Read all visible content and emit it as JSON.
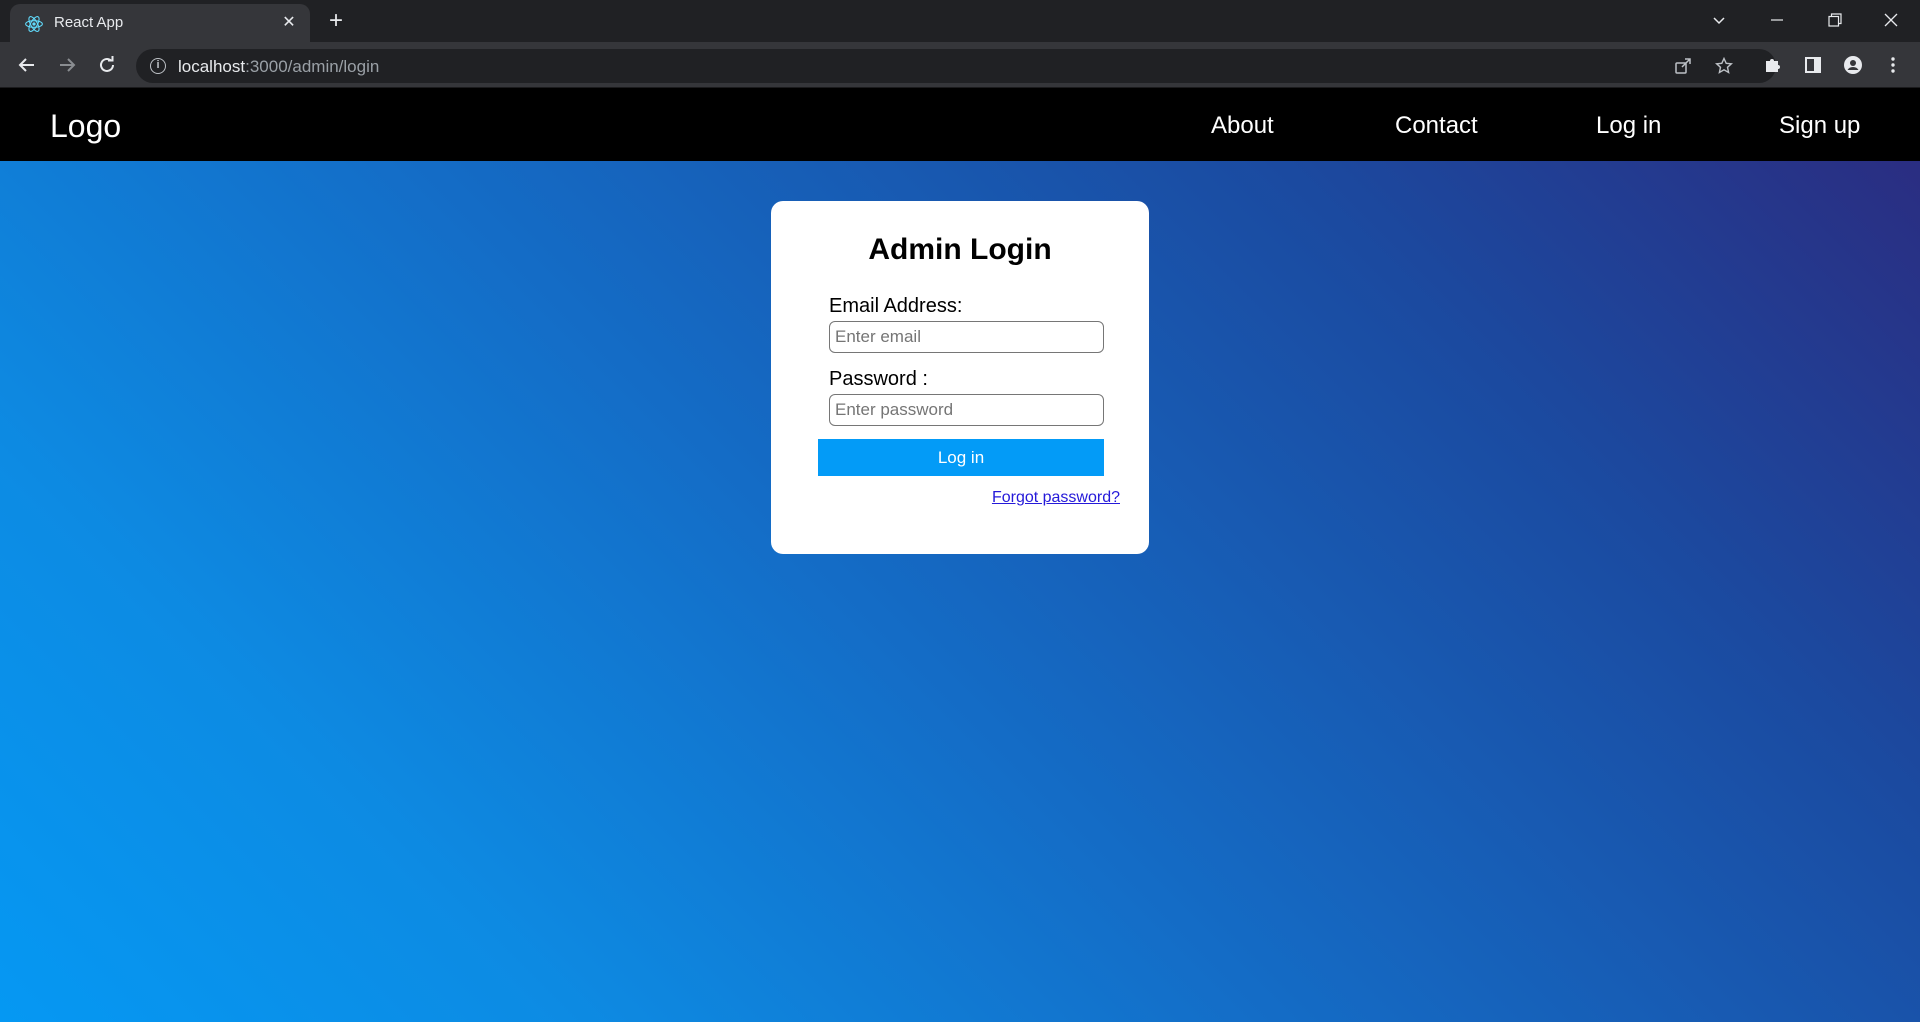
{
  "browser": {
    "tab_title": "React App",
    "tab_close": "✕",
    "new_tab": "+",
    "url_host": "localhost",
    "url_path": ":3000/admin/login",
    "icons": {
      "favicon": "react-icon",
      "back": "back-arrow-icon",
      "forward": "forward-arrow-icon",
      "reload": "reload-icon",
      "site_info": "info-icon",
      "share": "share-icon",
      "bookmark": "star-icon",
      "extensions": "puzzle-icon",
      "side_panel": "side-panel-icon",
      "profile": "profile-icon",
      "menu": "kebab-menu-icon",
      "tab_search": "chevron-down-icon",
      "minimize": "minimize-icon",
      "restore": "restore-icon",
      "close": "close-icon"
    }
  },
  "navbar": {
    "logo": "Logo",
    "links": [
      "About",
      "Contact",
      "Log in",
      "Sign up"
    ]
  },
  "login": {
    "title": "Admin Login",
    "email_label": "Email Address:",
    "email_placeholder": "Enter email",
    "email_value": "",
    "password_label": "Password :",
    "password_placeholder": "Enter password",
    "password_value": "",
    "submit_label": "Log in",
    "forgot_link": "Forgot password?"
  },
  "colors": {
    "navbar_bg": "#000000",
    "button_bg": "#039bf7",
    "link": "#2519d9",
    "gradient_top_right": "#2c2a7e",
    "gradient_bottom_left": "#0598f3"
  }
}
